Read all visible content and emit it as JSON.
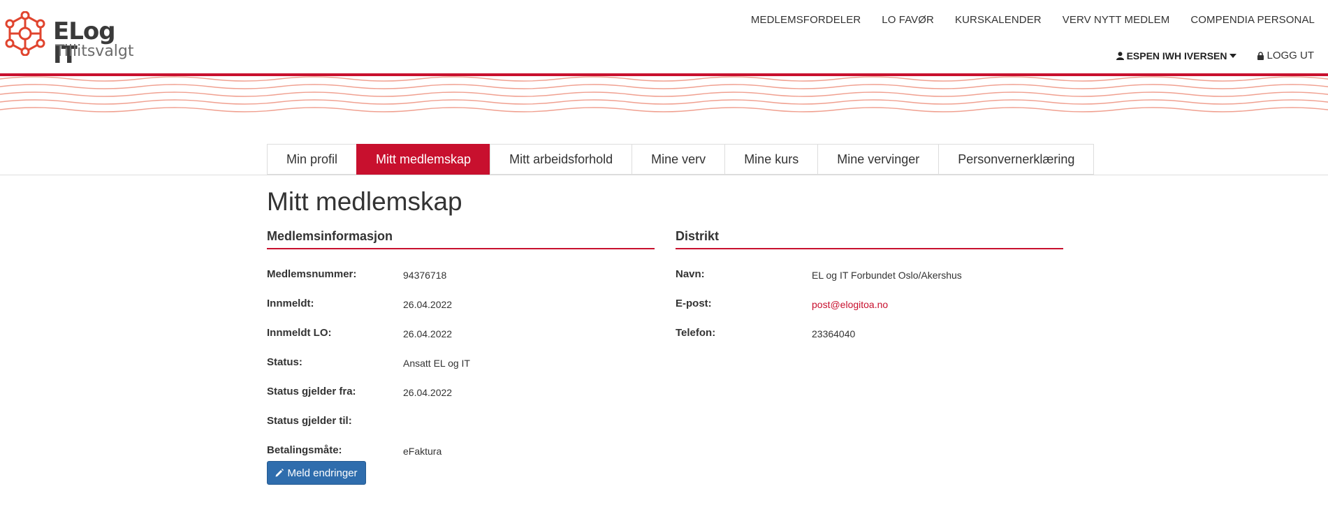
{
  "brand": {
    "name": "ELog IT",
    "tagline": "Tillitsvalgt"
  },
  "topnav": [
    {
      "label": "MEDLEMSFORDELER"
    },
    {
      "label": "LO FAVØR"
    },
    {
      "label": "KURSKALENDER"
    },
    {
      "label": "VERV NYTT MEDLEM"
    },
    {
      "label": "COMPENDIA PERSONAL"
    }
  ],
  "usernav": {
    "user": "ESPEN IWH IVERSEN",
    "logout": "LOGG UT"
  },
  "tabs": [
    {
      "label": "Min profil"
    },
    {
      "label": "Mitt medlemskap",
      "active": true
    },
    {
      "label": "Mitt arbeidsforhold"
    },
    {
      "label": "Mine verv"
    },
    {
      "label": "Mine kurs"
    },
    {
      "label": "Mine vervinger"
    },
    {
      "label": "Personvernerklæring"
    }
  ],
  "page_title": "Mitt medlemskap",
  "member": {
    "heading": "Medlemsinformasjon",
    "rows": [
      {
        "label": "Medlemsnummer:",
        "value": "94376718"
      },
      {
        "label": "Innmeldt:",
        "value": "26.04.2022"
      },
      {
        "label": "Innmeldt LO:",
        "value": "26.04.2022"
      },
      {
        "label": "Status:",
        "value": "Ansatt EL og IT"
      },
      {
        "label": "Status gjelder fra:",
        "value": "26.04.2022"
      },
      {
        "label": "Status gjelder til:",
        "value": ""
      },
      {
        "label": "Betalingsmåte:",
        "value": "eFaktura"
      }
    ],
    "button": "Meld endringer"
  },
  "district": {
    "heading": "Distrikt",
    "rows": [
      {
        "label": "Navn:",
        "value": "EL og IT Forbundet Oslo/Akershus"
      },
      {
        "label": "E-post:",
        "value": "post@elogitoa.no"
      },
      {
        "label": "Telefon:",
        "value": "23364040"
      }
    ]
  },
  "colors": {
    "accent": "#c8102e",
    "button": "#2f6dad",
    "wave": "#f0a090"
  },
  "icons": {
    "logo": "molecule-logo-icon",
    "user": "user-icon",
    "caret": "caret-down-icon",
    "lock": "lock-icon",
    "edit": "pencil-icon"
  }
}
